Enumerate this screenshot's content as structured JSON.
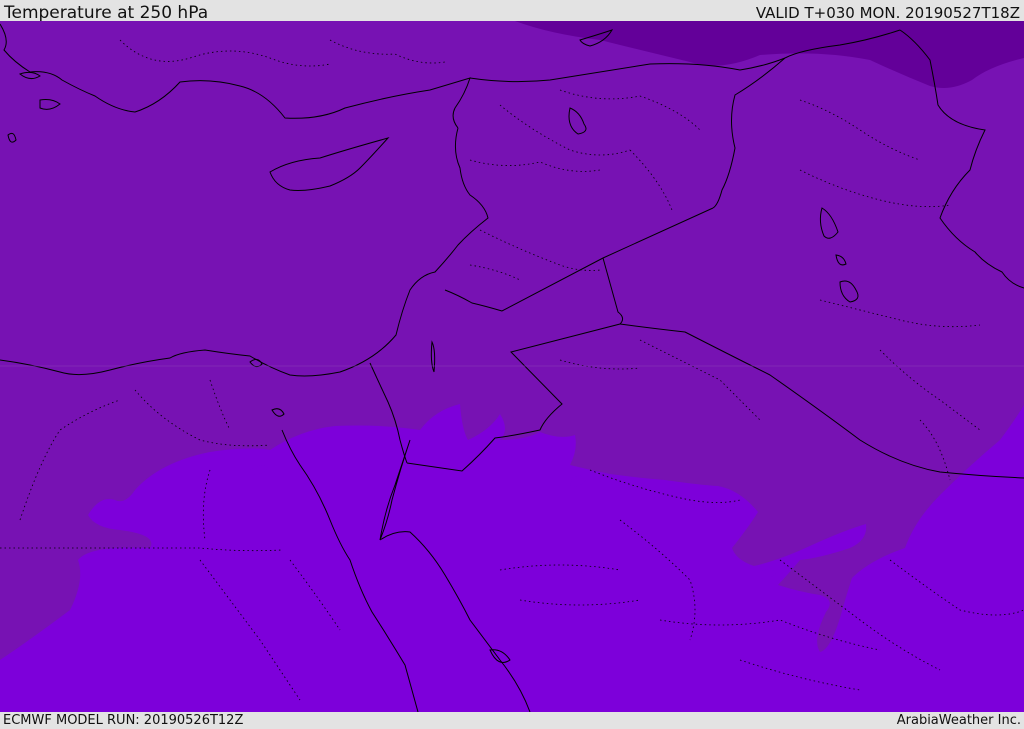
{
  "header": {
    "title": "Temperature at 250 hPa",
    "valid": "VALID T+030 MON. 20190527T18Z"
  },
  "footer": {
    "model_run": "ECMWF MODEL RUN: 20190526T12Z",
    "credit": "ArabiaWeather Inc."
  },
  "colors": {
    "band_cold": "#630099",
    "band_mid": "#7712b3",
    "band_warm": "#7d00da",
    "coastline": "#000000",
    "border": "#000000",
    "admin_boundary": "#000000",
    "bar_background": "#e3e3e3"
  }
}
